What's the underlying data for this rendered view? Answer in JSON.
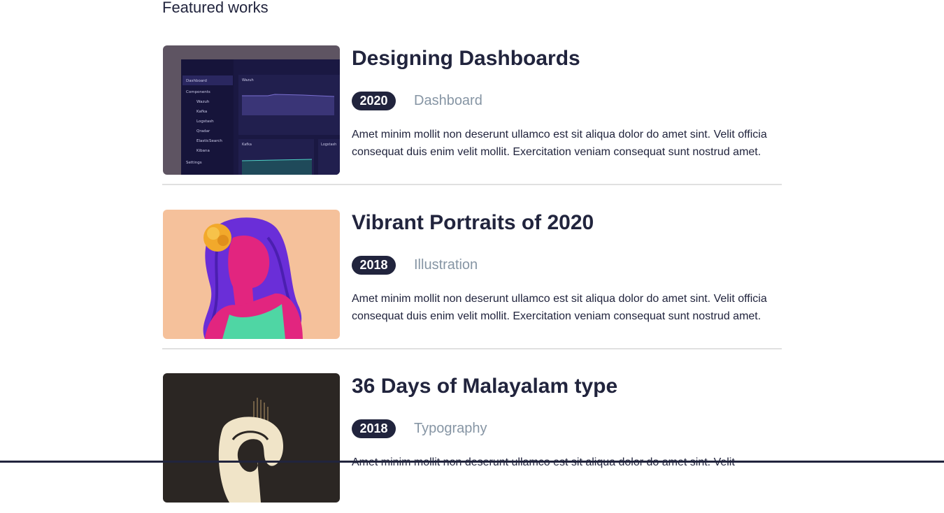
{
  "section": {
    "title": "Featured works"
  },
  "works": [
    {
      "title": "Designing Dashboards",
      "year": "2020",
      "category": "Dashboard",
      "description": "Amet minim mollit non deserunt ullamco est sit aliqua dolor do amet sint. Velit officia consequat duis enim velit mollit. Exercitation veniam consequat sunt nostrud amet.",
      "thumbnail": {
        "nav_items": [
          "Dashboard",
          "Components",
          "Wazuh",
          "Kafka",
          "Logstash",
          "Qradar",
          "ElasticSearch",
          "Kibana",
          "Settings"
        ],
        "panel_labels": [
          "Wazuh",
          "Kafka",
          "Logstash"
        ]
      }
    },
    {
      "title": "Vibrant Portraits of 2020",
      "year": "2018",
      "category": "Illustration",
      "description": "Amet minim mollit non deserunt ullamco est sit aliqua dolor do amet sint. Velit officia consequat duis enim velit mollit. Exercitation veniam consequat sunt nostrud amet."
    },
    {
      "title": "36 Days of Malayalam type",
      "year": "2018",
      "category": "Typography",
      "description": "Amet minim mollit non deserunt ullamco est sit aliqua dolor do amet sint. Velit"
    }
  ],
  "colors": {
    "text": "#21243d",
    "muted": "#8695a4",
    "divider": "#e0e0e0",
    "badge_bg": "#21243d"
  }
}
